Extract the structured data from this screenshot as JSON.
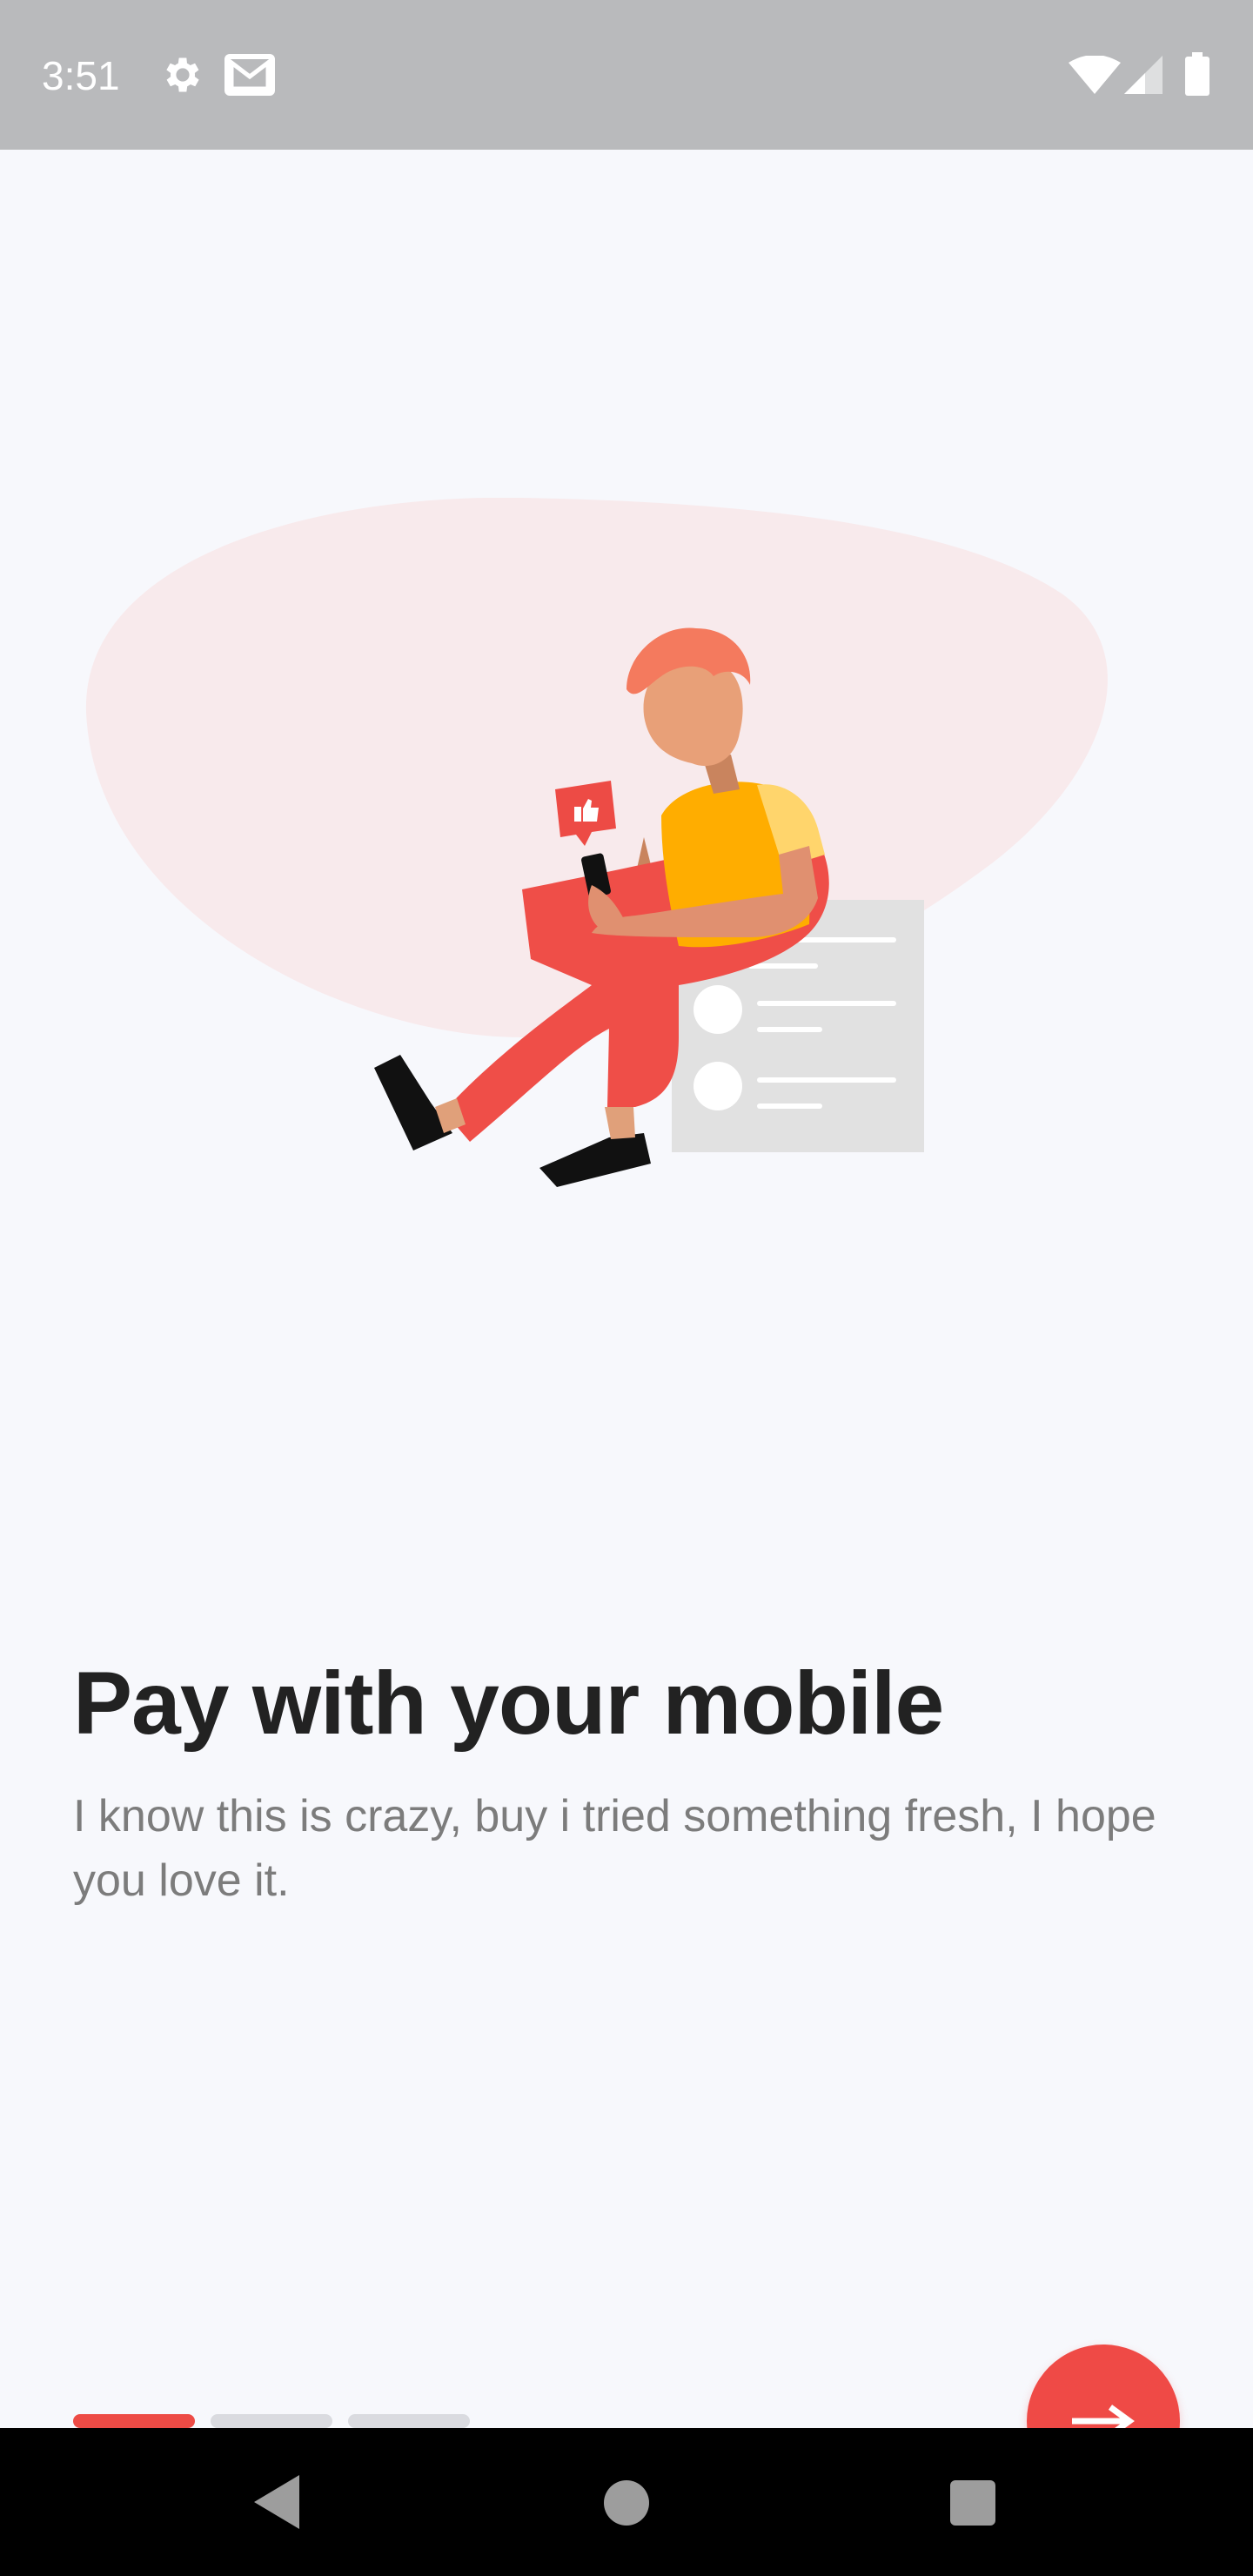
{
  "status_bar": {
    "time": "3:51",
    "icons": [
      "gear-icon",
      "gmail-icon",
      "wifi-icon",
      "signal-icon",
      "battery-icon"
    ]
  },
  "onboarding": {
    "illustration": "person-using-phone-illustration",
    "title": "Pay with your mobile",
    "description": "I know this is crazy, buy i tried something fresh, I hope you love it.",
    "page_indicator": {
      "current": 1,
      "total": 3
    },
    "next_button": {
      "icon": "arrow-right-icon"
    }
  },
  "nav_bar": {
    "icons": [
      "back-icon",
      "home-icon",
      "recents-icon"
    ]
  },
  "colors": {
    "accent": "#ef4a46",
    "status_bar": "#b9babc",
    "background": "#f7f8fc",
    "title": "#222222",
    "description": "#7c7c7c",
    "indicator_inactive": "#dadbe0"
  }
}
